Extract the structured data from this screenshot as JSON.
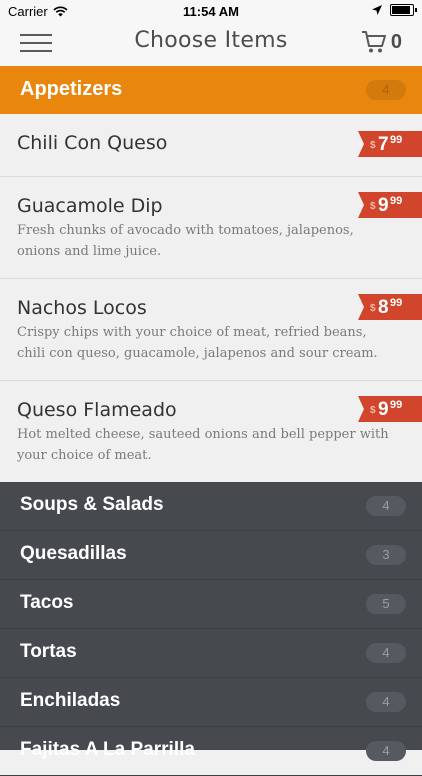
{
  "status_bar": {
    "carrier": "Carrier",
    "time": "11:54 AM"
  },
  "nav": {
    "title": "Choose Items",
    "cart_count": "0"
  },
  "active_category": {
    "name": "Appetizers",
    "count": "4"
  },
  "items": [
    {
      "title": "Chili Con Queso",
      "description": "",
      "price_dollar": "$",
      "price_whole": "7",
      "price_cents": "99"
    },
    {
      "title": "Guacamole Dip",
      "description": "Fresh chunks of avocado with tomatoes, jalapenos, onions and lime juice.",
      "price_dollar": "$",
      "price_whole": "9",
      "price_cents": "99"
    },
    {
      "title": "Nachos Locos",
      "description": "Crispy chips with your choice of meat, refried beans, chili con queso, guacamole, jalapenos and sour cream.",
      "price_dollar": "$",
      "price_whole": "8",
      "price_cents": "99"
    },
    {
      "title": "Queso Flameado",
      "description": "Hot melted cheese, sauteed onions and bell pepper with your choice of meat.",
      "price_dollar": "$",
      "price_whole": "9",
      "price_cents": "99"
    }
  ],
  "categories": [
    {
      "name": "Soups & Salads",
      "count": "4"
    },
    {
      "name": "Quesadillas",
      "count": "3"
    },
    {
      "name": "Tacos",
      "count": "5"
    },
    {
      "name": "Tortas",
      "count": "4"
    },
    {
      "name": "Enchiladas",
      "count": "4"
    },
    {
      "name": "Fajitas A La Parrilla",
      "count": "4"
    }
  ],
  "colors": {
    "accent_orange": "#e8860d",
    "price_red": "#d0452c",
    "dark_bg": "#464a4f"
  }
}
